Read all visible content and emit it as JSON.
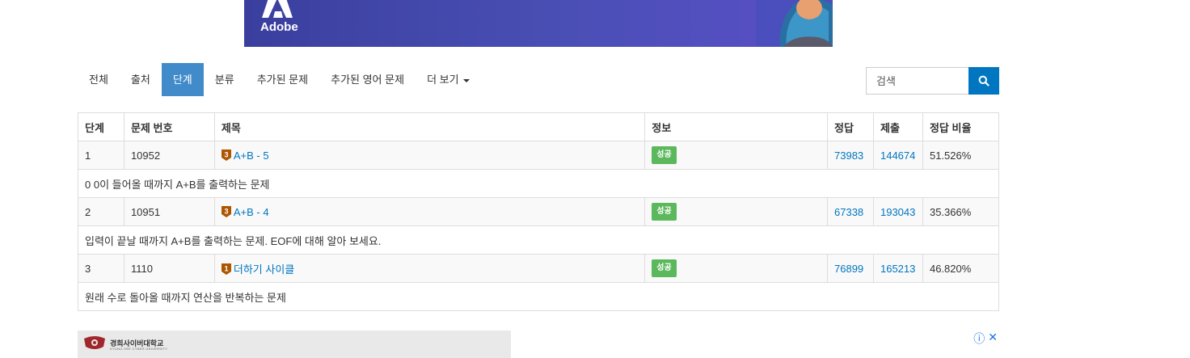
{
  "banner": {
    "brand": "Adobe"
  },
  "nav": {
    "tabs": [
      {
        "label": "전체",
        "active": false
      },
      {
        "label": "출처",
        "active": false
      },
      {
        "label": "단계",
        "active": true
      },
      {
        "label": "분류",
        "active": false
      },
      {
        "label": "추가된 문제",
        "active": false
      },
      {
        "label": "추가된 영어 문제",
        "active": false
      },
      {
        "label": "더 보기",
        "active": false,
        "dropdown": true
      }
    ]
  },
  "search": {
    "placeholder": "검색",
    "icon": "search-icon"
  },
  "table": {
    "headers": [
      "단계",
      "문제 번호",
      "제목",
      "정보",
      "정답",
      "제출",
      "정답 비율"
    ],
    "rows": [
      {
        "step": "1",
        "id": "10952",
        "tier": "3",
        "tier_color": "#ad5600",
        "title": "A+B - 5",
        "badge": "성공",
        "correct": "73983",
        "submit": "144674",
        "ratio": "51.526%",
        "desc": "0 0이 들어올 때까지 A+B를 출력하는 문제"
      },
      {
        "step": "2",
        "id": "10951",
        "tier": "3",
        "tier_color": "#ad5600",
        "title": "A+B - 4",
        "badge": "성공",
        "correct": "67338",
        "submit": "193043",
        "ratio": "35.366%",
        "desc": "입력이 끝날 때까지 A+B를 출력하는 문제. EOF에 대해 알아 보세요."
      },
      {
        "step": "3",
        "id": "1110",
        "tier": "1",
        "tier_color": "#ad5600",
        "title": "더하기 사이클",
        "badge": "성공",
        "correct": "76899",
        "submit": "165213",
        "ratio": "46.820%",
        "desc": "원래 수로 돌아올 때까지 연산을 반복하는 문제"
      }
    ]
  },
  "ad": {
    "name": "경희사이버대학교",
    "sub": "KYUNG HEE CYBER UNIVERSITY",
    "info_icon": "ⓘ",
    "close_icon": "✕"
  },
  "colors": {
    "accent": "#428bca",
    "link": "#0076c0",
    "success": "#5cb85c",
    "bronze": "#ad5600"
  }
}
